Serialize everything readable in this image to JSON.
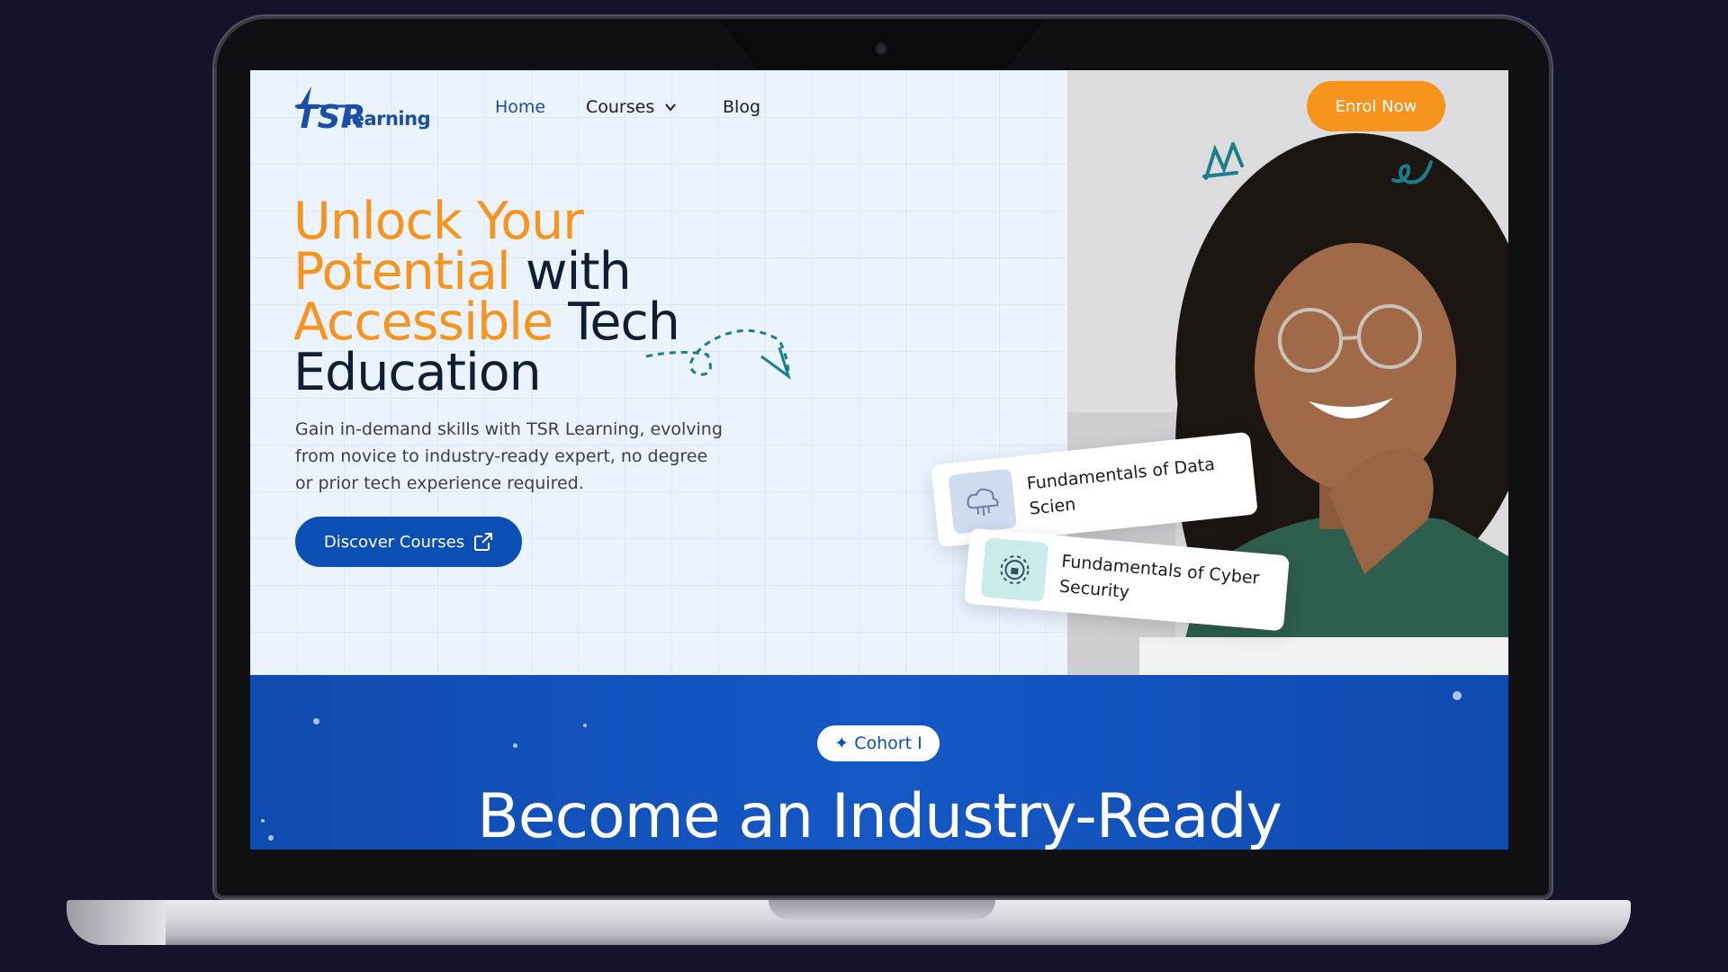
{
  "nav": {
    "logo_text": "learning",
    "links": [
      "Home",
      "Courses",
      "Blog"
    ],
    "cta": "Enrol Now"
  },
  "hero": {
    "headline_parts": [
      "Unlock Your",
      "Potential",
      "with",
      "Accessible",
      "Tech",
      "Education"
    ],
    "subtext": "Gain in-demand skills with TSR Learning, evolving from novice to industry-ready expert, no degree or prior tech experience required.",
    "button": "Discover Courses"
  },
  "cards": [
    {
      "title": "Fundamentals of Data Scien"
    },
    {
      "title": "Fundamentals of Cyber Security"
    }
  ],
  "band": {
    "pill": "Cohort I",
    "title": "Become an Industry-Ready"
  },
  "colors": {
    "accent_orange": "#f7941d",
    "primary_blue": "#0b4fb4",
    "band_blue": "#1558c4",
    "page_background": "#13132a"
  }
}
